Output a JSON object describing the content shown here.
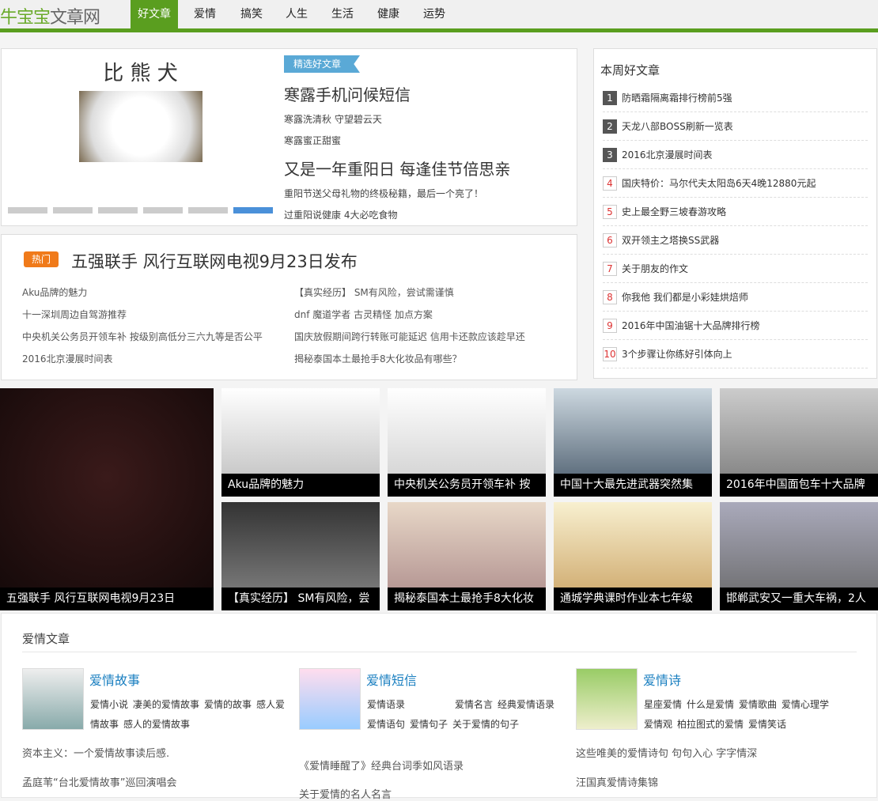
{
  "logo": {
    "green": "牛宝宝",
    "gray": "文章网"
  },
  "nav": [
    "好文章",
    "爱情",
    "搞笑",
    "人生",
    "生活",
    "健康",
    "运势"
  ],
  "slider": {
    "image_title": "比 熊 犬",
    "badge": "精选好文章",
    "headline1": "寒露手机问候短信",
    "links1": [
      "寒露洗清秋 守望碧云天",
      "寒露蜜正甜蜜"
    ],
    "headline2": "又是一年重阳日 每逢佳节倍思亲",
    "links2": [
      "重阳节送父母礼物的终极秘籍，最后一个亮了！",
      "过重阳说健康 4大必吃食物"
    ],
    "active_dot": 6
  },
  "hot": {
    "badge": "热门",
    "title": "五强联手 风行互联网电视9月23日发布",
    "left": [
      "Aku品牌的魅力",
      "十一深圳周边自驾游推荐",
      "中央机关公务员开领车补 按级别高低分三六九等是否公平",
      "2016北京漫展时间表"
    ],
    "right": [
      "【真实经历】 SM有风险，尝试需谨慎",
      "dnf 魔道学者 古灵精怪 加点方案",
      "国庆放假期间跨行转账可能延迟 信用卡还款应该趁早还",
      "揭秘泰国本土最抢手8大化妆品有哪些？"
    ]
  },
  "weekly": {
    "title": "本周好文章",
    "items": [
      "防晒霜隔离霜排行榜前5强",
      "天龙八部BOSS刷新一览表",
      "2016北京漫展时间表",
      "国庆特价：马尔代夫太阳岛6天4晚12880元起",
      "史上最全野三坡春游攻略",
      "双开领主之塔换SS武器",
      "关于朋友的作文",
      "你我他 我们都是小彩娃烘焙师",
      "2016年中国油锯十大品牌排行榜",
      "3个步骤让你练好引体向上"
    ]
  },
  "gallery": {
    "big": "五强联手 风行互联网电视9月23日",
    "tiles": [
      "Aku品牌的魅力",
      "中央机关公务员开领车补 按",
      "中国十大最先进武器突然集",
      "2016年中国面包车十大品牌",
      "【真实经历】 SM有风险，尝",
      "揭秘泰国本土最抢手8大化妆",
      "通城学典课时作业本七年级",
      "邯郸武安又一重大车祸，2人"
    ]
  },
  "love": {
    "title": "爱情文章",
    "cols": [
      {
        "name": "爱情故事",
        "tags": [
          "爱情小说",
          "凄美的爱情故事",
          "爱情的故事",
          "感人爱情故事",
          "感人的爱情故事"
        ],
        "articles": [
          "资本主义：一个爱情故事读后感.",
          "孟庭苇“台北爱情故事”巡回演唱会"
        ]
      },
      {
        "name": "爱情短信",
        "tags": [
          "爱情语录",
          "爱情名言",
          "经典爱情语录",
          "爱情语句",
          "爱情句子",
          "关于爱情的句子"
        ],
        "articles": [
          "《爱情睡醒了》经典台词季如风语录",
          "关于爱情的名人名言"
        ]
      },
      {
        "name": "爱情诗",
        "tags": [
          "星座爱情",
          "什么是爱情",
          "爱情歌曲",
          "爱情心理学",
          "爱情观",
          "柏拉图式的爱情",
          "爱情笑话"
        ],
        "articles": [
          "这些唯美的爱情诗句 句句入心 字字情深",
          "汪国真爱情诗集锦"
        ]
      }
    ]
  }
}
